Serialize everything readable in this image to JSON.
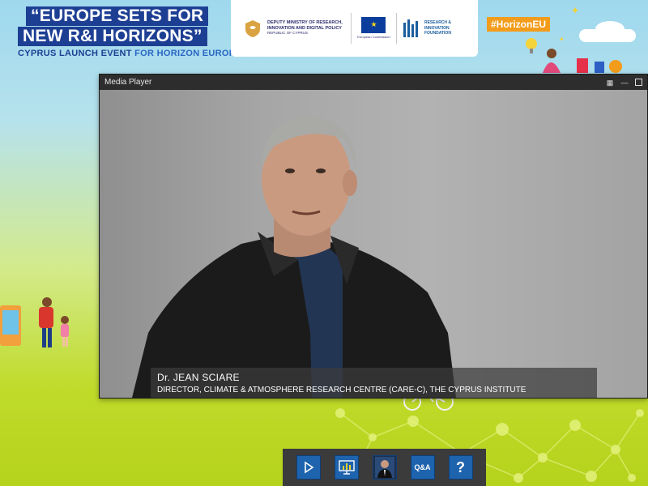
{
  "event": {
    "title_line1": "“EUROPE SETS FOR",
    "title_line2": "NEW R&I HORIZONS”",
    "subtitle_bold": "CYPRUS LAUNCH EVENT",
    "subtitle_rest": "FOR HORIZON EUROPE"
  },
  "logos": {
    "ministry_text": "DEPUTY MINISTRY OF RESEARCH, INNOVATION AND DIGITAL POLICY",
    "ministry_sub": "REPUBLIC OF CYPRUS",
    "eu_text": "European Commission",
    "rif_text": "RESEARCH & INNOVATION FOUNDATION"
  },
  "hashtag": "#HorizonEU",
  "media_player": {
    "title": "Media Player",
    "speaker_name": "Dr. JEAN SCIARE",
    "speaker_role": "DIRECTOR, CLIMATE & ATMOSPHERE RESEARCH CENTRE (CARE-C), THE CYPRUS INSTITUTE"
  },
  "toolbar": {
    "play_icon": "play-icon",
    "slides_icon": "presentation-icon",
    "speaker_icon": "speaker-photo-icon",
    "qa_label": "Q&A",
    "help_label": "?"
  },
  "colors": {
    "title_blue": "#1d3f93",
    "hashtag_orange": "#f39c1b",
    "toolbar_blue": "#1e63ad",
    "player_chrome": "#2d2d2d"
  }
}
